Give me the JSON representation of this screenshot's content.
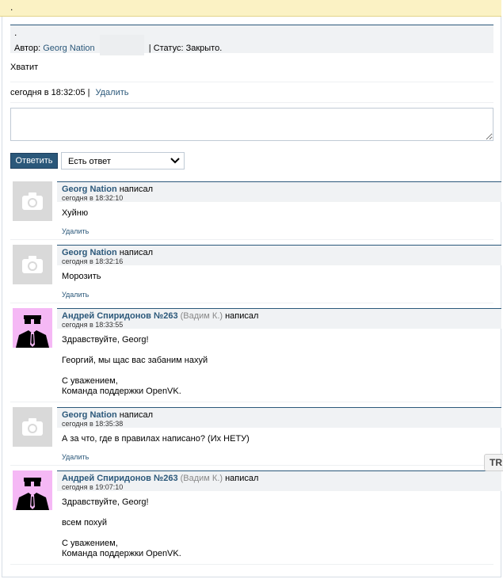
{
  "topbar": {
    "title": "."
  },
  "ticket": {
    "dot": ".",
    "author_label": "Автор:",
    "author_name": "Georg Nation",
    "status_text": "| Статус: Закрыто.",
    "text": "Хватит",
    "date": "сегодня в 18:32:05",
    "separator": "|",
    "delete_label": "Удалить"
  },
  "reply_form": {
    "button_label": "Ответить",
    "select_value": "Есть ответ"
  },
  "comments": [
    {
      "author": "Georg Nation",
      "nick": "",
      "wrote": "написал",
      "date": "сегодня в 18:32:10",
      "text": "Хуйню",
      "delete_label": "Удалить",
      "avatar": "camera-placeholder"
    },
    {
      "author": "Georg Nation",
      "nick": "",
      "wrote": "написал",
      "date": "сегодня в 18:32:16",
      "text": "Морозить",
      "delete_label": "Удалить",
      "avatar": "camera-placeholder"
    },
    {
      "author": "Андрей Спиридонов №263",
      "nick": "(Вадим К.)",
      "wrote": "написал",
      "date": "сегодня в 18:33:55",
      "text": "Здравствуйте, Georg!\n\nГеоргий, мы щас вас забаним нахуй\n\nС уважением,\nКоманда поддержки OpenVK.",
      "delete_label": "",
      "avatar": "agent-avatar"
    },
    {
      "author": "Georg Nation",
      "nick": "",
      "wrote": "написал",
      "date": "сегодня в 18:35:38",
      "text": "А за что, где в правилах написано? (Их НЕТУ)",
      "delete_label": "Удалить",
      "avatar": "camera-placeholder"
    },
    {
      "author": "Андрей Спиридонов №263",
      "nick": "(Вадим К.)",
      "wrote": "написал",
      "date": "сегодня в 19:07:10",
      "text": "Здравствуйте, Georg!\n\nвсем похуй\n\nС уважением,\nКоманда поддержки OpenVK.",
      "delete_label": "",
      "avatar": "agent-avatar"
    }
  ],
  "translate_badge": {
    "label": "TR"
  },
  "colors": {
    "link": "#2b587a",
    "topbar": "#fbf2c4",
    "header_bg": "#f0f2f4",
    "agent_avatar_bg": "#f5b8f5"
  }
}
